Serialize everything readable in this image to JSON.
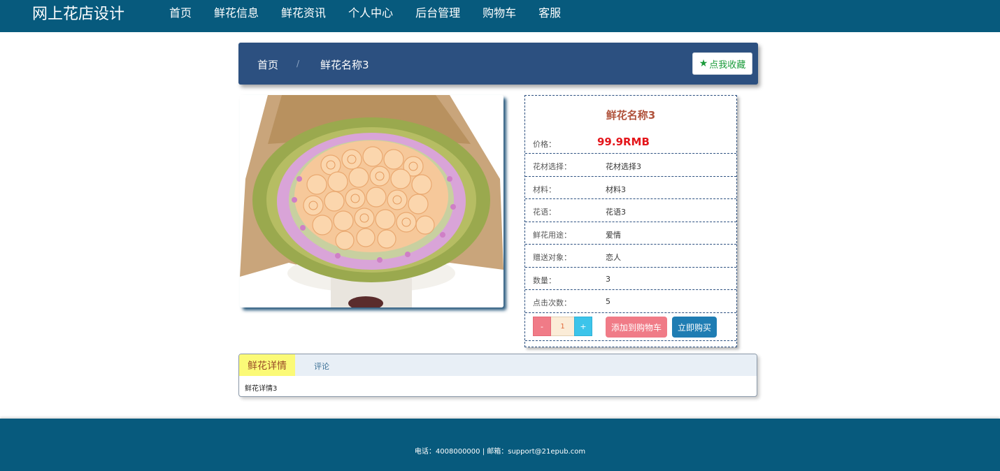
{
  "nav": {
    "brand": "网上花店设计",
    "items": [
      {
        "label": "首页",
        "active": false
      },
      {
        "label": "鲜花信息",
        "active": true
      },
      {
        "label": "鲜花资讯",
        "active": false
      },
      {
        "label": "个人中心",
        "active": false
      },
      {
        "label": "后台管理",
        "active": false
      },
      {
        "label": "购物车",
        "active": false
      },
      {
        "label": "客服",
        "active": false
      }
    ]
  },
  "breadcrumb": {
    "home": "首页",
    "separator": "/",
    "current": "鲜花名称3",
    "favorite_label": "点我收藏",
    "favorite_icon": "star-icon"
  },
  "product": {
    "image": "rose-bouquet",
    "name": "鲜花名称3",
    "price_label": "价格：",
    "price_value": "99.9RMB",
    "rows": [
      {
        "label": "花材选择：",
        "value": "花材选择3"
      },
      {
        "label": "材料：",
        "value": "材料3"
      },
      {
        "label": "花语：",
        "value": "花语3"
      },
      {
        "label": "鲜花用途：",
        "value": "爱情"
      },
      {
        "label": "赠送对象：",
        "value": "恋人"
      },
      {
        "label": "数量：",
        "value": "3"
      },
      {
        "label": "点击次数：",
        "value": "5"
      }
    ],
    "stepper": {
      "minus": "-",
      "value": "1",
      "plus": "+"
    },
    "add_to_cart": "添加到购物车",
    "buy_now": "立即购买"
  },
  "tabs": {
    "active": "鲜花详情",
    "other": "评论",
    "content": "鲜花详情3"
  },
  "footer": {
    "text": "电话：4008000000 | 邮箱：support@21epub.com"
  },
  "colors": {
    "nav_bg": "#075a7d",
    "breadcrumb_bg": "#2c5080",
    "price": "#e4161b",
    "title": "#b0533c",
    "add_cart": "#f07b87",
    "buy_now": "#1f7db3"
  }
}
